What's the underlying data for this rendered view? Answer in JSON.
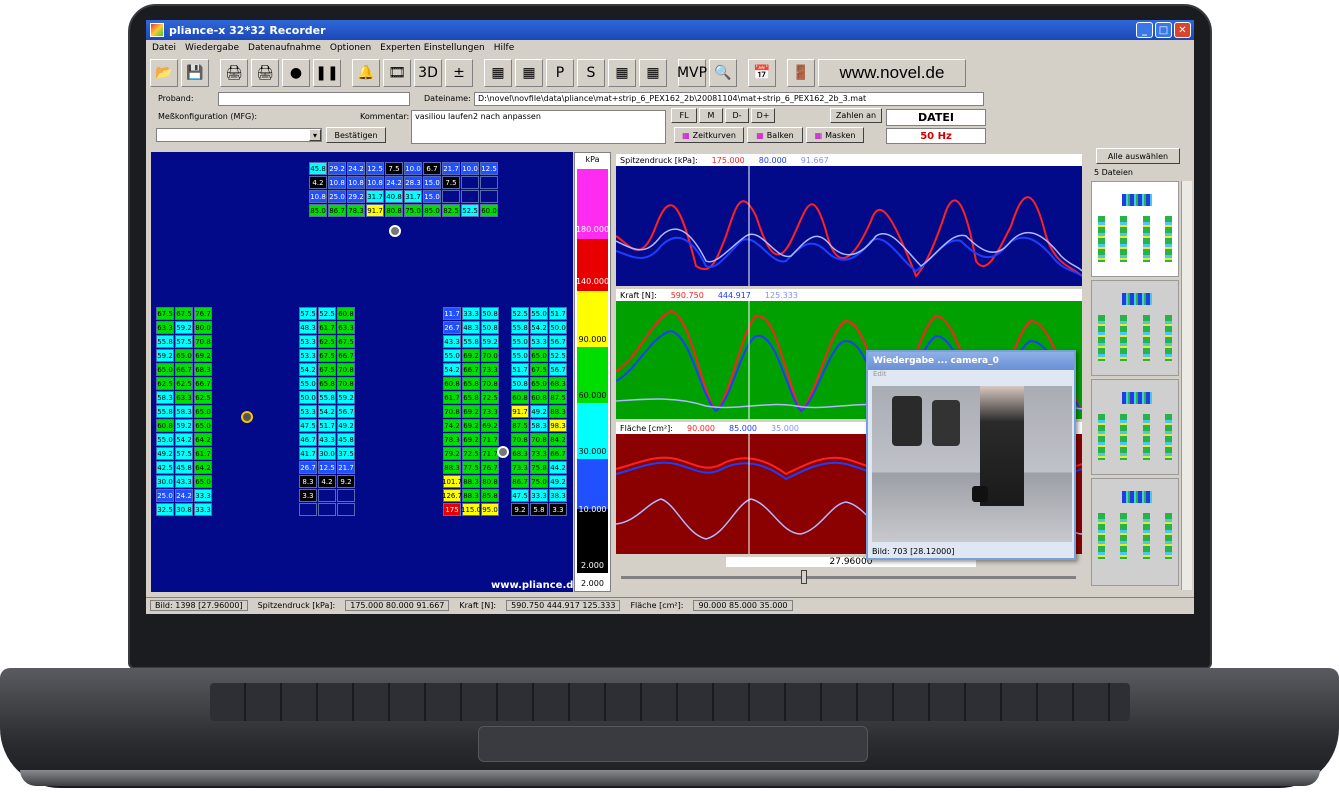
{
  "window": {
    "title": "pliance-x 32*32 Recorder",
    "minimize": "_",
    "maximize": "□",
    "close": "✕"
  },
  "menu": [
    "Datei",
    "Wiedergabe",
    "Datenaufnahme",
    "Optionen",
    "Experten Einstellungen",
    "Hilfe"
  ],
  "toolbar": {
    "novel_link": "www.novel.de",
    "mvp_label": "MVP"
  },
  "form": {
    "proband_label": "Proband:",
    "proband_value": "",
    "dateiname_label": "Dateiname:",
    "dateiname_value": "D:\\novel\\novfile\\data\\pliance\\mat+strip_6_PEX162_2b\\20081104\\mat+strip_6_PEX162_2b_3.mat",
    "messkonfig_label": "Meßkonfiguration (MFG):",
    "kommentar_label": "Kommentar:",
    "kommentar_value": "vasiliou laufen2 nach anpassen",
    "bestaetigen": "Bestätigen",
    "fl": "FL",
    "m": "M",
    "dminus": "D-",
    "dplus": "D+",
    "zahlen_an": "Zahlen an",
    "datei": "DATEI",
    "hz": "50 Hz",
    "zeitkurven": "Zeitkurven",
    "balken": "Balken",
    "masken": "Masken"
  },
  "top_rows": [
    [
      "45.8",
      "29.2",
      "24.2",
      "12.5",
      "7.5",
      "10.0",
      "6.7",
      "21.7",
      "10.0",
      "12.5"
    ],
    [
      "4.2",
      "10.8",
      "10.8",
      "10.8",
      "24.2",
      "28.3",
      "15.0",
      "7.5",
      "",
      ""
    ],
    [
      "10.8",
      "25.0",
      "29.2",
      "31.7",
      "40.8",
      "31.7",
      "15.0",
      "",
      "",
      ""
    ],
    [
      "85.0",
      "86.7",
      "78.3",
      "91.7",
      "80.8",
      "75.0",
      "85.0",
      "82.5",
      "52.5",
      "60.0"
    ]
  ],
  "strip_a": [
    [
      "67.5",
      "67.5",
      "76.7"
    ],
    [
      "63.3",
      "59.2",
      "80.0"
    ],
    [
      "55.8",
      "57.5",
      "70.8"
    ],
    [
      "59.2",
      "65.0",
      "69.2"
    ],
    [
      "65.0",
      "66.7",
      "68.3"
    ],
    [
      "62.5",
      "62.5",
      "66.7"
    ],
    [
      "58.3",
      "63.3",
      "62.5"
    ],
    [
      "55.8",
      "58.3",
      "65.0"
    ],
    [
      "60.8",
      "59.2",
      "65.0"
    ],
    [
      "55.0",
      "54.2",
      "64.2"
    ],
    [
      "49.2",
      "57.5",
      "61.7"
    ],
    [
      "42.5",
      "45.8",
      "64.2"
    ],
    [
      "30.0",
      "43.3",
      "65.0"
    ],
    [
      "25.0",
      "24.2",
      "33.3"
    ],
    [
      "32.5",
      "30.8",
      "33.3"
    ]
  ],
  "strip_b": [
    [
      "57.5",
      "52.5",
      "60.8"
    ],
    [
      "48.3",
      "61.7",
      "63.3"
    ],
    [
      "53.3",
      "62.5",
      "67.5"
    ],
    [
      "53.3",
      "67.5",
      "66.7"
    ],
    [
      "54.2",
      "67.5",
      "70.8"
    ],
    [
      "55.0",
      "65.8",
      "70.8"
    ],
    [
      "50.0",
      "55.8",
      "59.2"
    ],
    [
      "53.3",
      "54.2",
      "56.7"
    ],
    [
      "47.5",
      "51.7",
      "49.2"
    ],
    [
      "46.7",
      "43.3",
      "45.8"
    ],
    [
      "41.7",
      "30.0",
      "37.5"
    ],
    [
      "26.7",
      "12.5",
      "21.7"
    ],
    [
      "8.3",
      "4.2",
      "9.2"
    ],
    [
      "3.3",
      "",
      ""
    ],
    [
      "",
      "",
      ""
    ]
  ],
  "strip_c": [
    [
      "11.7",
      "33.3",
      "50.8"
    ],
    [
      "26.7",
      "48.3",
      "50.8"
    ],
    [
      "43.3",
      "55.8",
      "59.2"
    ],
    [
      "55.0",
      "69.2",
      "70.0"
    ],
    [
      "54.2",
      "66.7",
      "73.3"
    ],
    [
      "60.8",
      "65.8",
      "70.8"
    ],
    [
      "61.7",
      "65.8",
      "72.5"
    ],
    [
      "70.8",
      "69.2",
      "73.3"
    ],
    [
      "74.2",
      "69.2",
      "69.2"
    ],
    [
      "78.3",
      "69.2",
      "71.7"
    ],
    [
      "79.2",
      "72.5",
      "71.7"
    ],
    [
      "88.3",
      "77.5",
      "76.7"
    ],
    [
      "101.7",
      "88.3",
      "80.8"
    ],
    [
      "126.7",
      "88.3",
      "85.8"
    ],
    [
      "175",
      "115.0",
      "95.0"
    ]
  ],
  "strip_d": [
    [
      "52.5",
      "55.0",
      "51.7"
    ],
    [
      "55.8",
      "54.2",
      "50.0"
    ],
    [
      "55.0",
      "53.3",
      "56.7"
    ],
    [
      "55.0",
      "65.0",
      "52.5"
    ],
    [
      "51.7",
      "67.5",
      "56.7"
    ],
    [
      "50.8",
      "65.0",
      "68.3"
    ],
    [
      "60.8",
      "60.8",
      "87.5"
    ],
    [
      "91.7",
      "49.2",
      "88.3"
    ],
    [
      "87.5",
      "58.3",
      "98.3"
    ],
    [
      "70.8",
      "70.8",
      "84.2"
    ],
    [
      "68.3",
      "73.3",
      "66.7"
    ],
    [
      "73.3",
      "75.8",
      "44.2"
    ],
    [
      "86.7",
      "75.0",
      "49.2"
    ],
    [
      "47.5",
      "33.3",
      "38.3"
    ],
    [
      "9.2",
      "5.8",
      "3.3"
    ]
  ],
  "pliance_url": "www.pliance.de",
  "scale": {
    "unit": "kPa",
    "labels": [
      "180.000",
      "140.000",
      "90.000",
      "60.000",
      "30.000",
      "10.000",
      "2.000",
      "2.000"
    ]
  },
  "charts": {
    "spitzendruck": {
      "label": "Spitzendruck [kPa]:",
      "v1": "175.000",
      "v2": "80.000",
      "v3": "91.667"
    },
    "kraft": {
      "label": "Kraft [N]:",
      "v1": "590.750",
      "v2": "444.917",
      "v3": "125.333"
    },
    "flaeche": {
      "label": "Fläche [cm²]:",
      "v1": "90.000",
      "v2": "85.000",
      "v3": "35.000"
    },
    "time": "27.96000",
    "colors": {
      "max": "#ff2020",
      "mean": "#1f3dff",
      "min": "#b0b8ff"
    }
  },
  "video": {
    "title": "Wiedergabe ... camera_0",
    "menu": "Edit",
    "frame": "Bild: 703 [28.12000]"
  },
  "side": {
    "select_all": "Alle auswählen",
    "count": "5 Dateien"
  },
  "status": {
    "bild": "Bild: 1398 [27.96000]",
    "spitzen_label": "Spitzendruck [kPa]:",
    "spitzen": "175.000  80.000  91.667",
    "kraft_label": "Kraft [N]:",
    "kraft": "590.750  444.917  125.333",
    "flaeche_label": "Fläche [cm²]:",
    "flaeche": "90.000  85.000  35.000"
  }
}
